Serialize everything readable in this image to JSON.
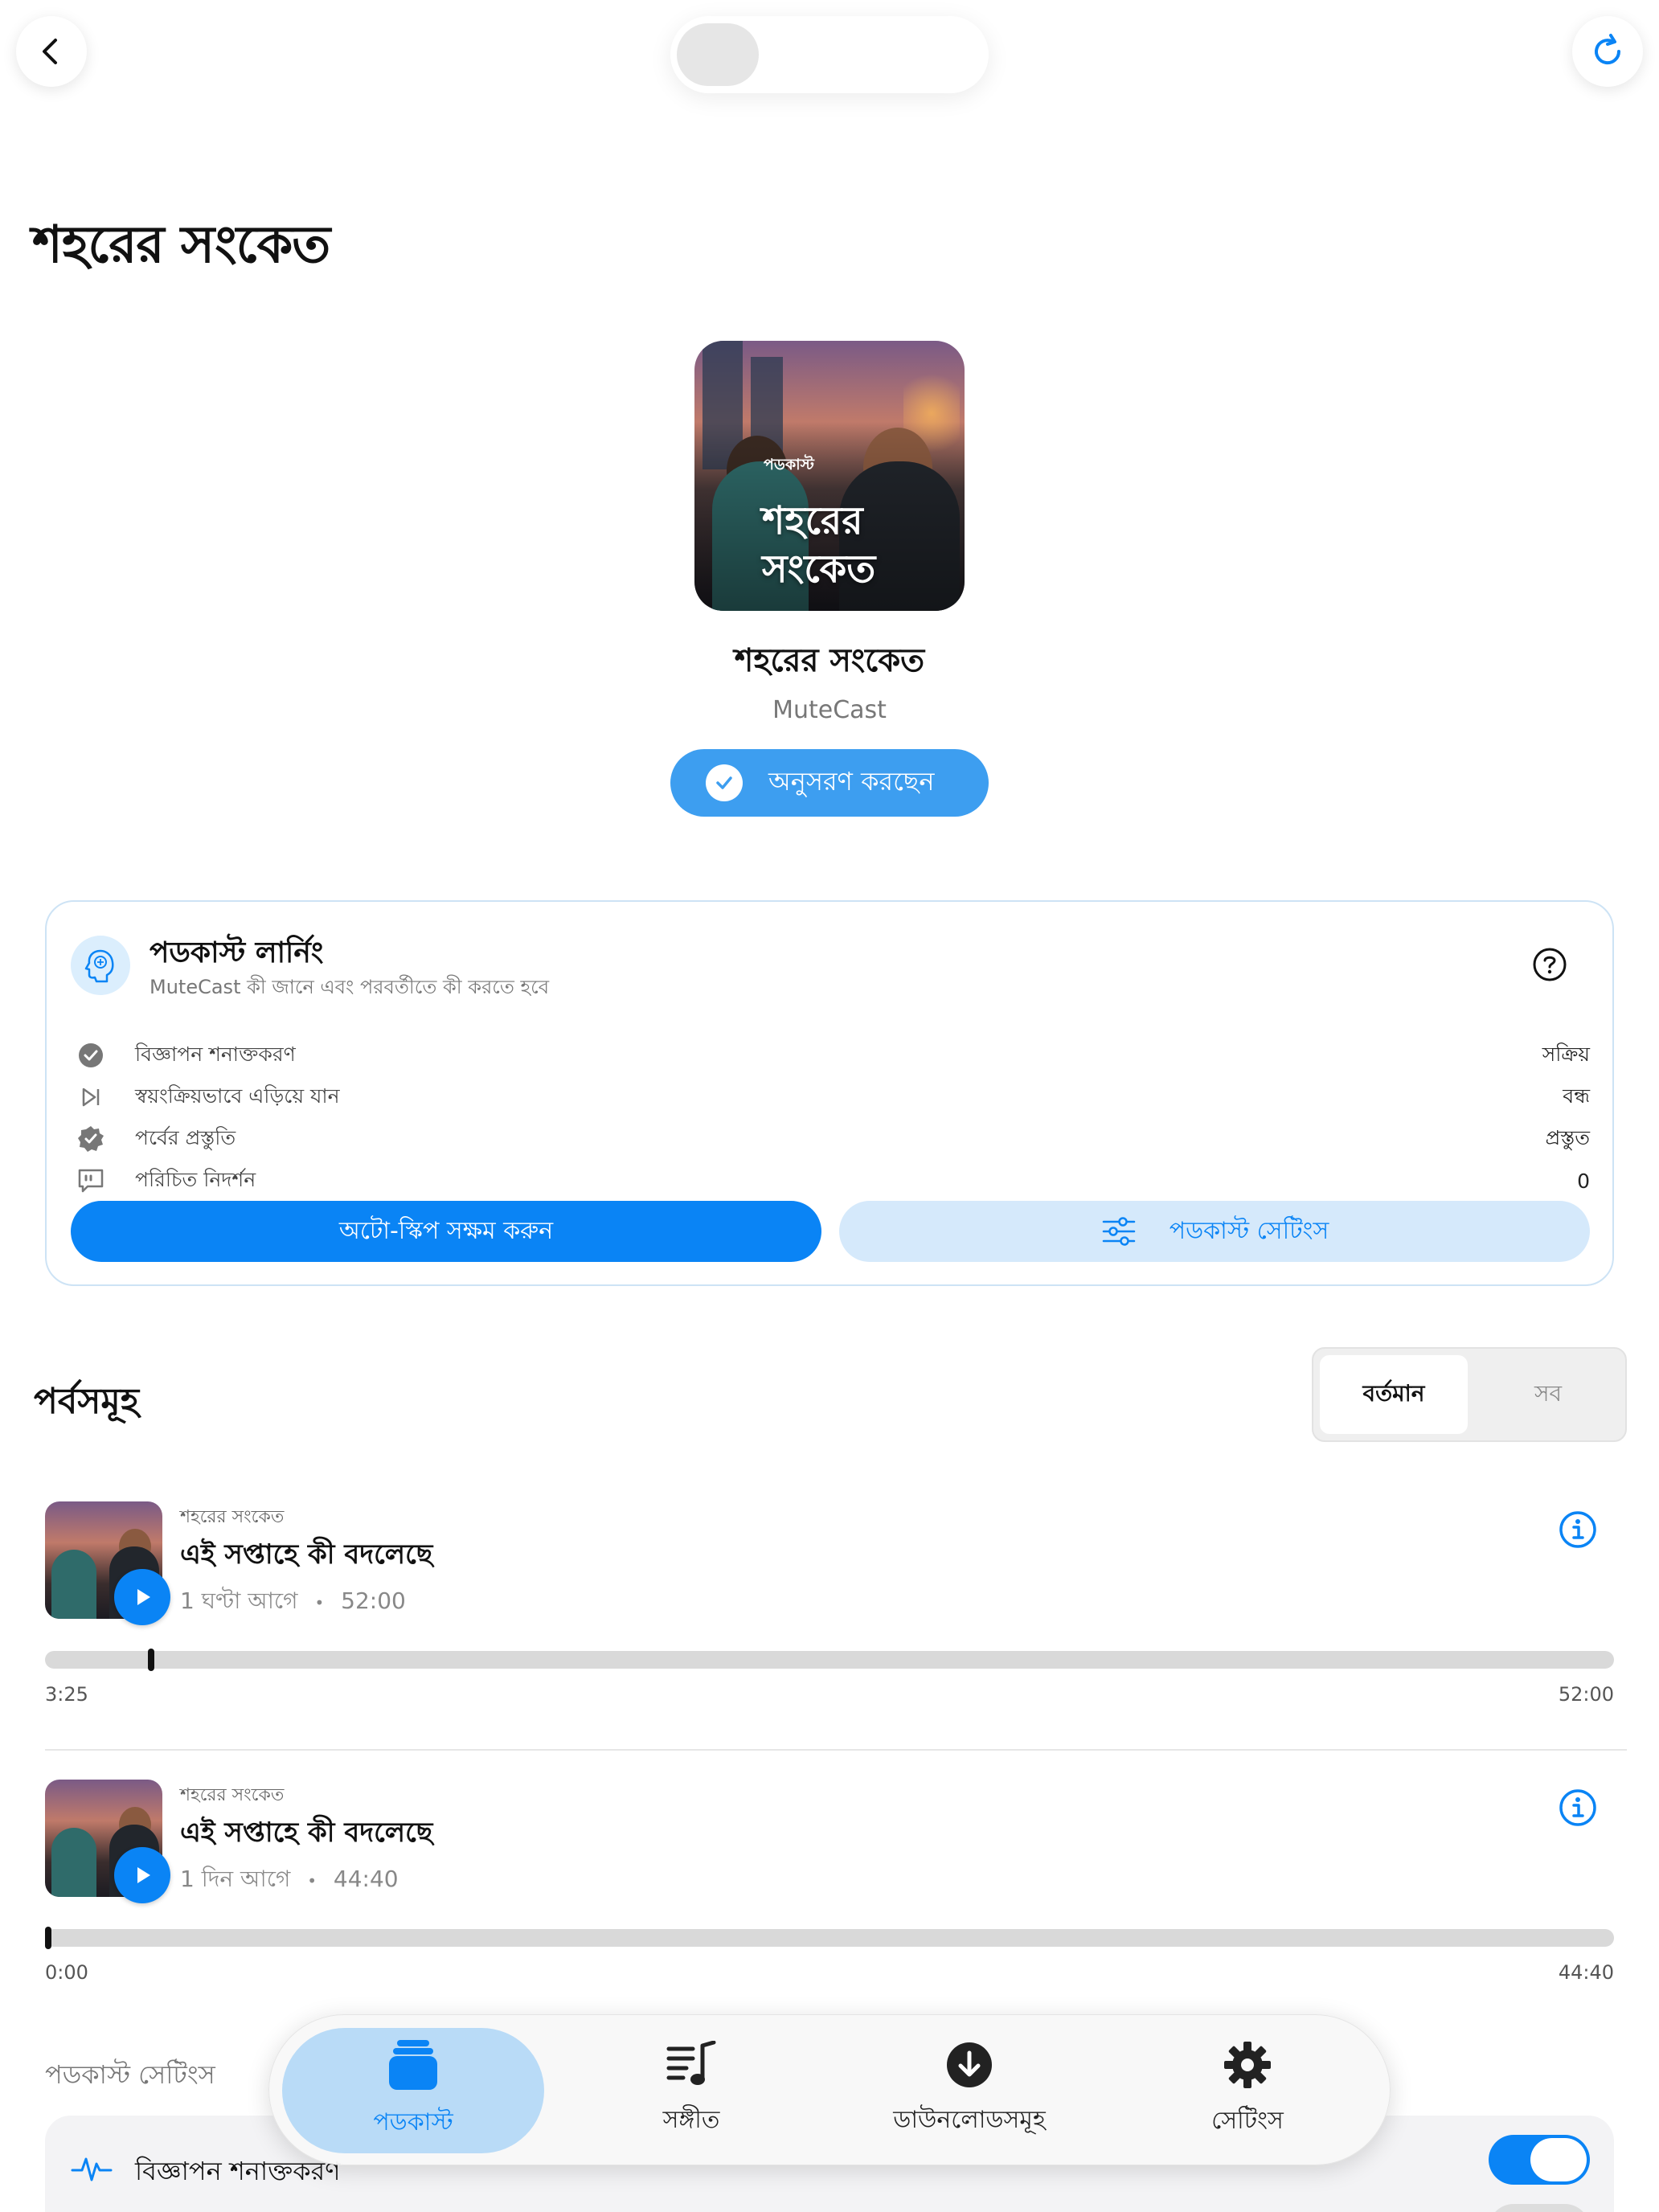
{
  "header": {
    "back_icon": "chevron-left-icon",
    "refresh_icon": "refresh-icon"
  },
  "page_title": "শহরের সংকেত",
  "podcast": {
    "cover_tag": "পডকাস্ট",
    "cover_title_line1": "শহরের",
    "cover_title_line2": "সংকেত",
    "title": "শহরের সংকেত",
    "author": "MuteCast",
    "follow_label": "অনুসরণ করছেন"
  },
  "learning": {
    "title": "পডকাস্ট লার্নিং",
    "subtitle": "MuteCast কী জানে এবং পরবর্তীতে কী করতে হবে",
    "rows": [
      {
        "icon": "check-circle-icon",
        "label": "বিজ্ঞাপন শনাক্তকরণ",
        "value": "সক্রিয়"
      },
      {
        "icon": "skip-forward-icon",
        "label": "স্বয়ংক্রিয়ভাবে এড়িয়ে যান",
        "value": "বন্ধ"
      },
      {
        "icon": "verified-badge-icon",
        "label": "পর্বের প্রস্তুতি",
        "value": "প্রস্তুত"
      },
      {
        "icon": "quote-bubble-icon",
        "label": "পরিচিত নিদর্শন",
        "value": "0"
      }
    ],
    "primary_button": "অটো-স্কিপ সক্ষম করুন",
    "secondary_button": "পডকাস্ট সেটিংস"
  },
  "episodes": {
    "heading": "পর্বসমূহ",
    "segment": {
      "current": "বর্তমান",
      "all": "সব"
    },
    "items": [
      {
        "source": "শহরের সংকেত",
        "title": "এই সপ্তাহে কী বদলেছে",
        "age": "1 ঘণ্টা আগে",
        "sep": "•",
        "duration": "52:00",
        "elapsed": "3:25",
        "total": "52:00",
        "progress": 0.066
      },
      {
        "source": "শহরের সংকেত",
        "title": "এই সপ্তাহে কী বদলেছে",
        "age": "1 দিন আগে",
        "sep": "•",
        "duration": "44:40",
        "elapsed": "0:00",
        "total": "44:40",
        "progress": 0.0
      }
    ]
  },
  "settings_section": {
    "label": "পডকাস্ট সেটিংস",
    "row_label": "বিজ্ঞাপন শনাক্তকরণ",
    "row_toggle_on": true
  },
  "tabbar": {
    "tabs": [
      {
        "label": "পডকাস্ট",
        "icon": "podcast-stack-icon",
        "active": true
      },
      {
        "label": "সঙ্গীত",
        "icon": "music-list-icon",
        "active": false
      },
      {
        "label": "ডাউনলোডসমূহ",
        "icon": "download-icon",
        "active": false
      },
      {
        "label": "সেটিংস",
        "icon": "gear-icon",
        "active": false
      }
    ]
  },
  "colors": {
    "accent": "#0a84f5",
    "follow": "#3d9ef0",
    "accent_light": "#d5e9fb"
  }
}
